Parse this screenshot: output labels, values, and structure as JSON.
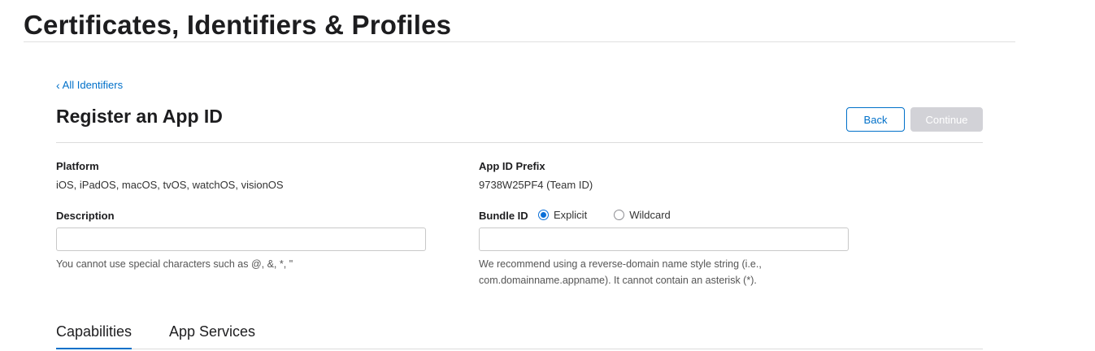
{
  "header": {
    "title": "Certificates, Identifiers & Profiles"
  },
  "nav": {
    "back_link": "All Identifiers",
    "back_icon": "chevron-left-icon"
  },
  "section": {
    "title": "Register an App ID"
  },
  "actions": {
    "back_label": "Back",
    "continue_label": "Continue"
  },
  "platform": {
    "label": "Platform",
    "value": "iOS, iPadOS, macOS, tvOS, watchOS, visionOS"
  },
  "app_id_prefix": {
    "label": "App ID Prefix",
    "value": "9738W25PF4 (Team ID)"
  },
  "description": {
    "label": "Description",
    "value": "",
    "hint": "You cannot use special characters such as @, &, *, \""
  },
  "bundle_id": {
    "label": "Bundle ID",
    "value": "",
    "options": [
      {
        "label": "Explicit",
        "selected": true
      },
      {
        "label": "Wildcard",
        "selected": false
      }
    ],
    "hint_line1": "We recommend using a reverse-domain name style string (i.e.,",
    "hint_line2": "com.domainname.appname). It cannot contain an asterisk (*)."
  },
  "tabs": [
    {
      "label": "Capabilities",
      "active": true
    },
    {
      "label": "App Services",
      "active": false
    }
  ],
  "colors": {
    "accent": "#0070c9",
    "disabled_button": "#d2d2d7",
    "radio_selected": "#0a6fd8"
  }
}
